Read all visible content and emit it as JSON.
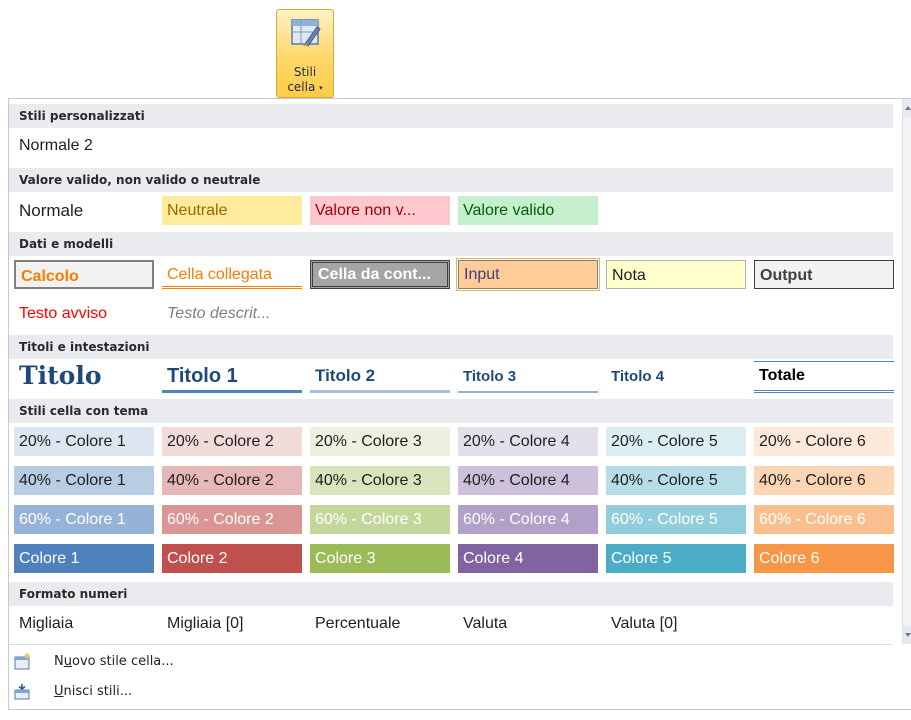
{
  "ribbon": {
    "button_line1": "Stili",
    "button_line2": "cella",
    "dropdown_glyph": "▾",
    "icon": "cell-styles-icon"
  },
  "sections": {
    "custom": "Stili personalizzati",
    "good_bad": "Valore valido, non valido o neutrale",
    "data_model": "Dati e modelli",
    "titles": "Titoli e intestazioni",
    "themed": "Stili cella con tema",
    "number": "Formato numeri"
  },
  "custom": {
    "normale2": "Normale 2"
  },
  "good_bad": {
    "normale": "Normale",
    "neutrale": "Neutrale",
    "non_valido": "Valore non v...",
    "valido": "Valore valido"
  },
  "data_model": {
    "calcolo": "Calcolo",
    "collegata": "Cella collegata",
    "controllo": "Cella da cont...",
    "input": "Input",
    "nota": "Nota",
    "output": "Output",
    "avviso": "Testo avviso",
    "descrittivo": "Testo descrit..."
  },
  "titles": {
    "titolo": "Titolo",
    "t1": "Titolo 1",
    "t2": "Titolo 2",
    "t3": "Titolo 3",
    "t4": "Titolo 4",
    "totale": "Totale"
  },
  "themed": {
    "r20": [
      "20% - Colore 1",
      "20% - Colore 2",
      "20% - Colore 3",
      "20% - Colore 4",
      "20% - Colore 5",
      "20% - Colore 6"
    ],
    "r40": [
      "40% - Colore 1",
      "40% - Colore 2",
      "40% - Colore 3",
      "40% - Colore 4",
      "40% - Colore 5",
      "40% - Colore 6"
    ],
    "r60": [
      "60% - Colore 1",
      "60% - Colore 2",
      "60% - Colore 3",
      "60% - Colore 4",
      "60% - Colore 5",
      "60% - Colore 6"
    ],
    "r100": [
      "Colore 1",
      "Colore 2",
      "Colore 3",
      "Colore 4",
      "Colore 5",
      "Colore 6"
    ]
  },
  "number": {
    "migliaia": "Migliaia",
    "migliaia0": "Migliaia [0]",
    "percentuale": "Percentuale",
    "valuta": "Valuta",
    "valuta0": "Valuta [0]"
  },
  "commands": {
    "new_style": "Nuovo stile cella...",
    "new_style_accel": "u",
    "merge": "Unisci stili...",
    "merge_accel": "U"
  },
  "colors": {
    "accent1": "#4f81bd",
    "accent2": "#c0504d",
    "accent3": "#9bbb59",
    "accent4": "#8064a2",
    "accent5": "#4bacc6",
    "accent6": "#f79646",
    "neutral_bg": "#ffeb9c",
    "bad_bg": "#ffc7ce",
    "good_bg": "#c6efce"
  }
}
